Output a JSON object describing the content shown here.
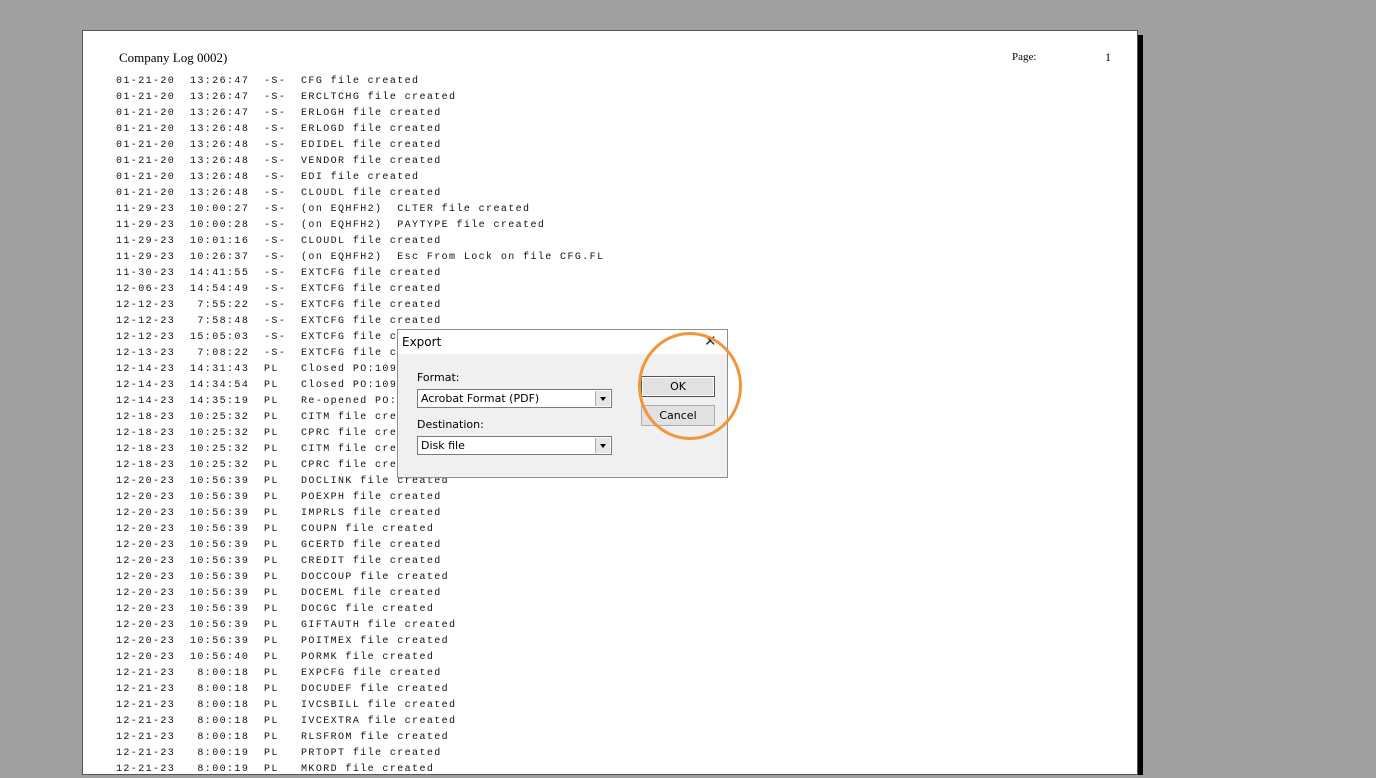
{
  "report": {
    "title": "Company Log 0002)",
    "page_label": "Page:",
    "page_number": "1",
    "lines": [
      "01-21-20  13:26:47  -S-  CFG file created",
      "01-21-20  13:26:47  -S-  ERCLTCHG file created",
      "01-21-20  13:26:47  -S-  ERLOGH file created",
      "01-21-20  13:26:48  -S-  ERLOGD file created",
      "01-21-20  13:26:48  -S-  EDIDEL file created",
      "01-21-20  13:26:48  -S-  VENDOR file created",
      "01-21-20  13:26:48  -S-  EDI file created",
      "01-21-20  13:26:48  -S-  CLOUDL file created",
      "11-29-23  10:00:27  -S-  (on EQHFH2)  CLTER file created",
      "11-29-23  10:00:28  -S-  (on EQHFH2)  PAYTYPE file created",
      "11-29-23  10:01:16  -S-  CLOUDL file created",
      "11-29-23  10:26:37  -S-  (on EQHFH2)  Esc From Lock on file CFG.FL",
      "11-30-23  14:41:55  -S-  EXTCFG file created",
      "12-06-23  14:54:49  -S-  EXTCFG file created",
      "12-12-23   7:55:22  -S-  EXTCFG file created",
      "12-12-23   7:58:48  -S-  EXTCFG file created",
      "12-12-23  15:05:03  -S-  EXTCFG file c",
      "12-13-23   7:08:22  -S-  EXTCFG file c",
      "12-14-23  14:31:43  PL   Closed PO:109",
      "12-14-23  14:34:54  PL   Closed PO:109",
      "12-14-23  14:35:19  PL   Re-opened PO:",
      "12-18-23  10:25:32  PL   CITM file cre",
      "12-18-23  10:25:32  PL   CPRC file cre",
      "12-18-23  10:25:32  PL   CITM file cre",
      "12-18-23  10:25:32  PL   CPRC file cre",
      "12-20-23  10:56:39  PL   DOCLINK file created",
      "12-20-23  10:56:39  PL   POEXPH file created",
      "12-20-23  10:56:39  PL   IMPRLS file created",
      "12-20-23  10:56:39  PL   COUPN file created",
      "12-20-23  10:56:39  PL   GCERTD file created",
      "12-20-23  10:56:39  PL   CREDIT file created",
      "12-20-23  10:56:39  PL   DOCCOUP file created",
      "12-20-23  10:56:39  PL   DOCEML file created",
      "12-20-23  10:56:39  PL   DOCGC file created",
      "12-20-23  10:56:39  PL   GIFTAUTH file created",
      "12-20-23  10:56:39  PL   POITMEX file created",
      "12-20-23  10:56:40  PL   PORMK file created",
      "12-21-23   8:00:18  PL   EXPCFG file created",
      "12-21-23   8:00:18  PL   DOCUDEF file created",
      "12-21-23   8:00:18  PL   IVCSBILL file created",
      "12-21-23   8:00:18  PL   IVCEXTRA file created",
      "12-21-23   8:00:18  PL   RLSFROM file created",
      "12-21-23   8:00:19  PL   PRTOPT file created",
      "12-21-23   8:00:19  PL   MKORD file created"
    ]
  },
  "dialog": {
    "title": "Export",
    "close_icon": "close-icon",
    "format_label": "Format:",
    "format_value": "Acrobat Format (PDF)",
    "destination_label": "Destination:",
    "destination_value": "Disk file",
    "ok_label": "OK",
    "cancel_label": "Cancel"
  },
  "colors": {
    "backdrop": "#a0a0a0",
    "page": "#ffffff",
    "dialog": "#f0f0f0",
    "highlight": "#f2953b"
  }
}
